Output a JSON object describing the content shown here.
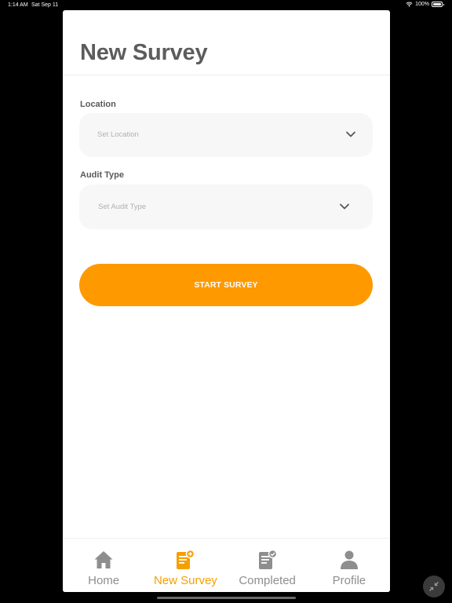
{
  "status_bar": {
    "time": "1:14 AM",
    "date": "Sat Sep 11",
    "battery_text": "100%",
    "battery_level": 1.0
  },
  "page": {
    "title": "New Survey"
  },
  "form": {
    "location": {
      "label": "Location",
      "placeholder": "Set Location",
      "icon": "chevron-down-icon"
    },
    "audit_type": {
      "label": "Audit Type",
      "placeholder": "Set Audit Type",
      "icon": "chevron-down-icon"
    },
    "start_button_label": "START SURVEY"
  },
  "tabs": [
    {
      "label": "Home",
      "icon": "home-icon",
      "active": false
    },
    {
      "label": "New Survey",
      "icon": "new-survey-icon",
      "active": true
    },
    {
      "label": "Completed",
      "icon": "completed-icon",
      "active": false
    },
    {
      "label": "Profile",
      "icon": "profile-icon",
      "active": false
    }
  ],
  "colors": {
    "accent": "#ff9900",
    "active_tab": "#f5a000",
    "inactive_tab": "#8e8e8e",
    "title_text": "#5c5c5c",
    "field_background": "#f7f7f7"
  }
}
